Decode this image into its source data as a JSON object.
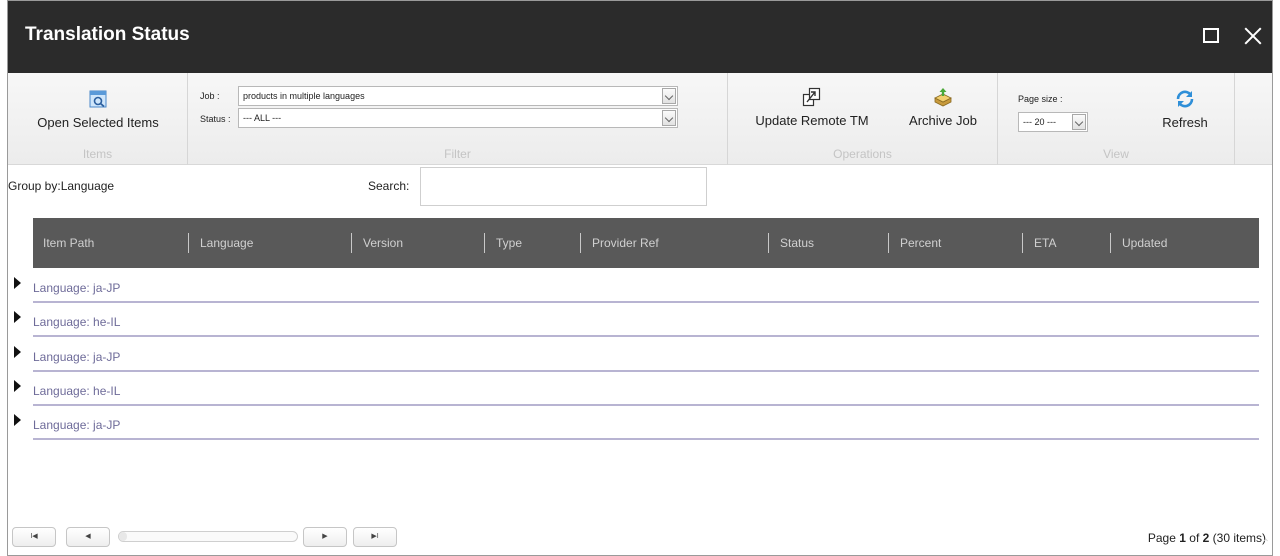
{
  "window": {
    "title": "Translation Status"
  },
  "ribbon": {
    "items_group": {
      "open_button": "Open Selected Items",
      "label": "Items"
    },
    "filter_group": {
      "job_label": "Job :",
      "job_value": "products in multiple languages",
      "status_label": "Status :",
      "status_value": "--- ALL ---",
      "label": "Filter"
    },
    "operations_group": {
      "update_button": "Update Remote TM",
      "archive_button": "Archive Job",
      "label": "Operations"
    },
    "view_group": {
      "page_size_label": "Page size :",
      "page_size_value": "--- 20 ---",
      "refresh_button": "Refresh",
      "label": "View"
    }
  },
  "toolbar": {
    "group_by": "Group by:Language",
    "search_label": "Search:",
    "search_value": ""
  },
  "grid": {
    "columns": [
      "Item Path",
      "Language",
      "Version",
      "Type",
      "Provider Ref",
      "Status",
      "Percent",
      "ETA",
      "Updated"
    ],
    "groups": [
      "Language: ja-JP",
      "Language: he-IL",
      "Language: ja-JP",
      "Language: he-IL",
      "Language: ja-JP"
    ]
  },
  "pager": {
    "first": "I◀",
    "prev": "◀",
    "next": "▶",
    "last": "▶I",
    "page_prefix": "Page",
    "current_page": "1",
    "of_text": "of",
    "total_pages": "2",
    "items_text": "(30 items)"
  },
  "colors": {
    "titlebar": "#2b2b2b",
    "grid_header": "#595959",
    "group_link": "#6e6b99",
    "group_underline": "#b8b4d2"
  }
}
